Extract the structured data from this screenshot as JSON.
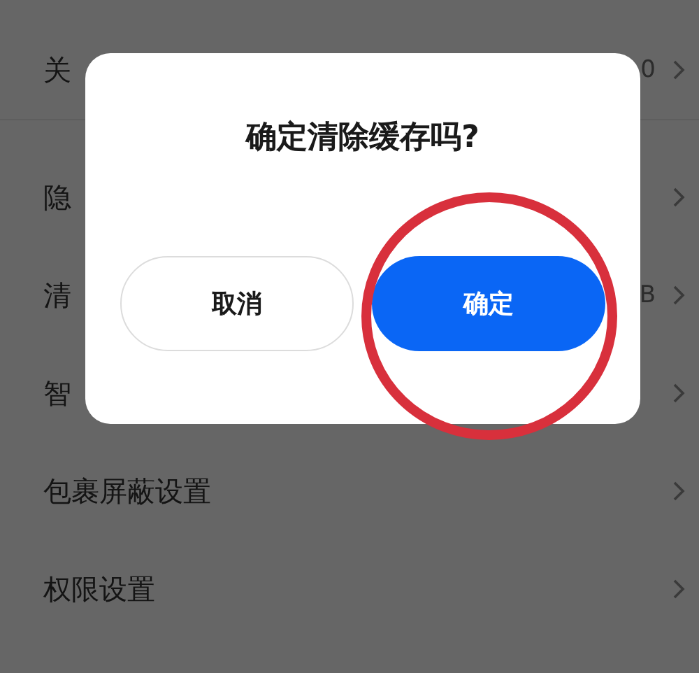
{
  "settings": [
    {
      "label": "关",
      "value": "0"
    },
    {
      "label": "隐"
    },
    {
      "label": "清",
      "value": "B"
    },
    {
      "label": "智"
    },
    {
      "label": "包裹屏蔽设置"
    },
    {
      "label": "权限设置"
    }
  ],
  "dialog": {
    "title": "确定清除缓存吗?",
    "buttons": [
      {
        "label": "取消",
        "kind": "secondary"
      },
      {
        "label": "确定",
        "kind": "primary"
      }
    ]
  }
}
